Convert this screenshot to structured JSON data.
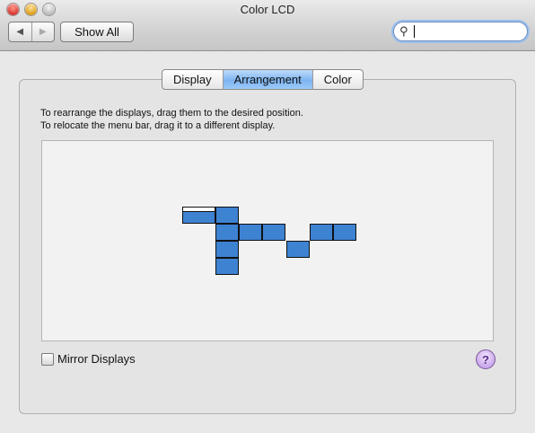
{
  "window": {
    "title": "Color LCD"
  },
  "toolbar": {
    "back_icon": "arrow-left",
    "forward_icon": "arrow-right",
    "show_all_label": "Show All",
    "search_value": "",
    "search_icon": "magnifier"
  },
  "tabs": [
    {
      "label": "Display",
      "active": false
    },
    {
      "label": "Arrangement",
      "active": true
    },
    {
      "label": "Color",
      "active": false
    }
  ],
  "instructions": {
    "line1": "To rearrange the displays, drag them to the desired position.",
    "line2": "To relocate the menu bar, drag it to a different display."
  },
  "displays_count": 10,
  "mirror": {
    "label": "Mirror Displays",
    "checked": false
  },
  "help_label": "?",
  "colors": {
    "display_fill": "#3e82d2",
    "active_tab": "#7db4f0"
  }
}
